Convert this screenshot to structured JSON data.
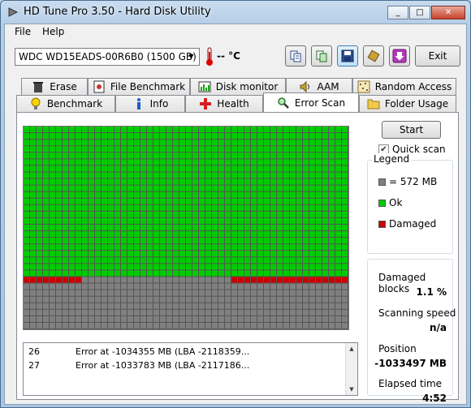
{
  "window": {
    "title": "HD Tune Pro 3.50 - Hard Disk Utility",
    "min": "_",
    "max": "□",
    "close": "✕"
  },
  "menu": {
    "file": "File",
    "help": "Help"
  },
  "toolbar": {
    "drive": "WDC WD15EADS-00R6B0 (1500 GB)",
    "temperature": "-- °C",
    "exit": "Exit"
  },
  "tabs_top": [
    {
      "label": "Erase",
      "icon": "trash-icon"
    },
    {
      "label": "File Benchmark",
      "icon": "file-benchmark-icon"
    },
    {
      "label": "Disk monitor",
      "icon": "disk-monitor-icon"
    },
    {
      "label": "AAM",
      "icon": "speaker-icon"
    },
    {
      "label": "Random Access",
      "icon": "random-access-icon"
    }
  ],
  "tabs_bottom": [
    {
      "label": "Benchmark",
      "icon": "lightbulb-icon"
    },
    {
      "label": "Info",
      "icon": "info-icon"
    },
    {
      "label": "Health",
      "icon": "health-cross-icon"
    },
    {
      "label": "Error Scan",
      "icon": "magnifier-icon",
      "selected": true
    },
    {
      "label": "Folder Usage",
      "icon": "folder-icon"
    }
  ],
  "scan": {
    "start": "Start",
    "quick_scan_label": "Quick scan",
    "quick_scan_checked": true,
    "grid": {
      "columns": 50,
      "rows": 31,
      "green_rows": 23,
      "damaged_row": 23,
      "damaged_left_blocks": 9,
      "damaged_right_start": 32,
      "colors": {
        "ok": "#00cc00",
        "damaged": "#cc0000",
        "unscanned": "#808080"
      }
    }
  },
  "legend": {
    "title": "Legend",
    "items": [
      {
        "label": "= 572 MB",
        "color": "#808080"
      },
      {
        "label": "Ok",
        "color": "#00cc00"
      },
      {
        "label": "Damaged",
        "color": "#cc0000"
      }
    ]
  },
  "stats": {
    "damaged_blocks_label": "Damaged blocks",
    "damaged_blocks_value": "1.1 %",
    "speed_label": "Scanning speed",
    "speed_value": "n/a",
    "position_label": "Position",
    "position_value": "-1033497 MB",
    "elapsed_label": "Elapsed time",
    "elapsed_value": "4:52"
  },
  "log": [
    {
      "num": "26",
      "msg": "Error at -1034355 MB (LBA -2118359..."
    },
    {
      "num": "27",
      "msg": "Error at -1033783 MB (LBA -2117186..."
    }
  ]
}
